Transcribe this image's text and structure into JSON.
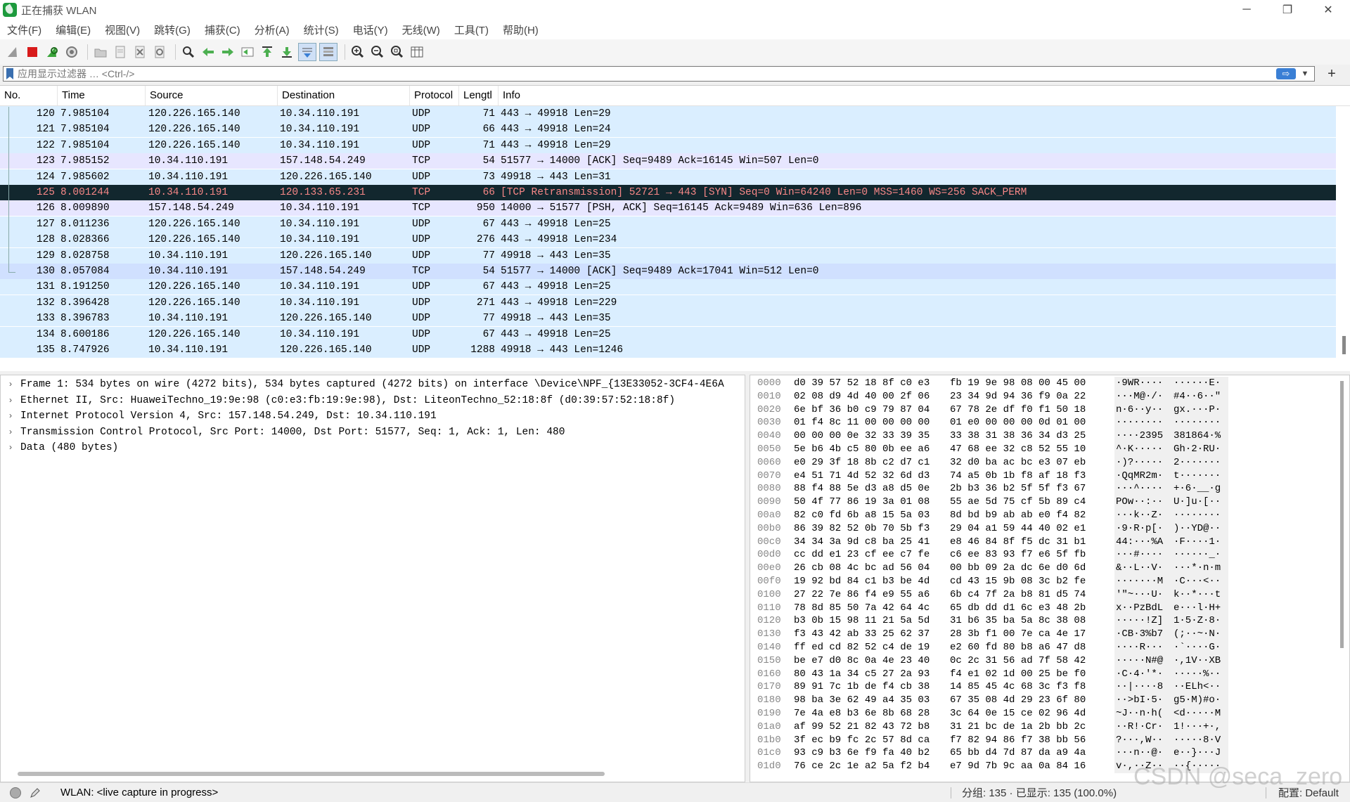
{
  "window": {
    "title": "正在捕获 WLAN",
    "minimize": "─",
    "restore": "❐",
    "close": "✕"
  },
  "menu": [
    "文件(F)",
    "编辑(E)",
    "视图(V)",
    "跳转(G)",
    "捕获(C)",
    "分析(A)",
    "统计(S)",
    "电话(Y)",
    "无线(W)",
    "工具(T)",
    "帮助(H)"
  ],
  "toolbar": {
    "icons": [
      "shark-fin-start-icon",
      "stop-capture-icon",
      "restart-capture-icon",
      "capture-options-icon",
      "sep",
      "open-file-icon",
      "save-file-icon",
      "close-file-icon",
      "reload-file-icon",
      "sep",
      "find-packet-icon",
      "go-back-icon",
      "go-forward-icon",
      "go-to-packet-icon",
      "go-first-icon",
      "go-last-icon",
      "auto-scroll-icon",
      "colorize-icon",
      "sep",
      "zoom-in-icon",
      "zoom-out-icon",
      "zoom-normal-icon",
      "resize-columns-icon"
    ]
  },
  "filter": {
    "placeholder": "应用显示过滤器 … <Ctrl-/>",
    "apply": "⇨",
    "dropdown": "▼",
    "add": "+"
  },
  "packet_list": {
    "columns": [
      "No.",
      "Time",
      "Source",
      "Destination",
      "Protocol",
      "Lengtl",
      "Info"
    ],
    "rows": [
      {
        "no": "120",
        "time": "7.985104",
        "src": "120.226.165.140",
        "dst": "10.34.110.191",
        "proto": "UDP",
        "len": "71",
        "info": "443 → 49918 Len=29",
        "style": "udp"
      },
      {
        "no": "121",
        "time": "7.985104",
        "src": "120.226.165.140",
        "dst": "10.34.110.191",
        "proto": "UDP",
        "len": "66",
        "info": "443 → 49918 Len=24",
        "style": "udp"
      },
      {
        "no": "122",
        "time": "7.985104",
        "src": "120.226.165.140",
        "dst": "10.34.110.191",
        "proto": "UDP",
        "len": "71",
        "info": "443 → 49918 Len=29",
        "style": "udp"
      },
      {
        "no": "123",
        "time": "7.985152",
        "src": "10.34.110.191",
        "dst": "157.148.54.249",
        "proto": "TCP",
        "len": "54",
        "info": "51577 → 14000 [ACK] Seq=9489 Ack=16145 Win=507 Len=0",
        "style": "tcp"
      },
      {
        "no": "124",
        "time": "7.985602",
        "src": "10.34.110.191",
        "dst": "120.226.165.140",
        "proto": "UDP",
        "len": "73",
        "info": "49918 → 443 Len=31",
        "style": "udp"
      },
      {
        "no": "125",
        "time": "8.001244",
        "src": "10.34.110.191",
        "dst": "120.133.65.231",
        "proto": "TCP",
        "len": "66",
        "info": "[TCP Retransmission] 52721 → 443 [SYN] Seq=0 Win=64240 Len=0 MSS=1460 WS=256 SACK_PERM",
        "style": "sel"
      },
      {
        "no": "126",
        "time": "8.009890",
        "src": "157.148.54.249",
        "dst": "10.34.110.191",
        "proto": "TCP",
        "len": "950",
        "info": "14000 → 51577 [PSH, ACK] Seq=16145 Ack=9489 Win=636 Len=896",
        "style": "tcp"
      },
      {
        "no": "127",
        "time": "8.011236",
        "src": "120.226.165.140",
        "dst": "10.34.110.191",
        "proto": "UDP",
        "len": "67",
        "info": "443 → 49918 Len=25",
        "style": "udp"
      },
      {
        "no": "128",
        "time": "8.028366",
        "src": "120.226.165.140",
        "dst": "10.34.110.191",
        "proto": "UDP",
        "len": "276",
        "info": "443 → 49918 Len=234",
        "style": "udp"
      },
      {
        "no": "129",
        "time": "8.028758",
        "src": "10.34.110.191",
        "dst": "120.226.165.140",
        "proto": "UDP",
        "len": "77",
        "info": "49918 → 443 Len=35",
        "style": "udp"
      },
      {
        "no": "130",
        "time": "8.057084",
        "src": "10.34.110.191",
        "dst": "157.148.54.249",
        "proto": "TCP",
        "len": "54",
        "info": "51577 → 14000 [ACK] Seq=9489 Ack=17041 Win=512 Len=0",
        "style": "hl"
      },
      {
        "no": "131",
        "time": "8.191250",
        "src": "120.226.165.140",
        "dst": "10.34.110.191",
        "proto": "UDP",
        "len": "67",
        "info": "443 → 49918 Len=25",
        "style": "udp"
      },
      {
        "no": "132",
        "time": "8.396428",
        "src": "120.226.165.140",
        "dst": "10.34.110.191",
        "proto": "UDP",
        "len": "271",
        "info": "443 → 49918 Len=229",
        "style": "udp"
      },
      {
        "no": "133",
        "time": "8.396783",
        "src": "10.34.110.191",
        "dst": "120.226.165.140",
        "proto": "UDP",
        "len": "77",
        "info": "49918 → 443 Len=35",
        "style": "udp"
      },
      {
        "no": "134",
        "time": "8.600186",
        "src": "120.226.165.140",
        "dst": "10.34.110.191",
        "proto": "UDP",
        "len": "67",
        "info": "443 → 49918 Len=25",
        "style": "udp"
      },
      {
        "no": "135",
        "time": "8.747926",
        "src": "10.34.110.191",
        "dst": "120.226.165.140",
        "proto": "UDP",
        "len": "1288",
        "info": "49918 → 443 Len=1246",
        "style": "udp"
      }
    ]
  },
  "details": [
    "Frame 1: 534 bytes on wire (4272 bits), 534 bytes captured (4272 bits) on interface \\Device\\NPF_{13E33052-3CF4-4E6A",
    "Ethernet II, Src: HuaweiTechno_19:9e:98 (c0:e3:fb:19:9e:98), Dst: LiteonTechno_52:18:8f (d0:39:57:52:18:8f)",
    "Internet Protocol Version 4, Src: 157.148.54.249, Dst: 10.34.110.191",
    "Transmission Control Protocol, Src Port: 14000, Dst Port: 51577, Seq: 1, Ack: 1, Len: 480",
    "Data (480 bytes)"
  ],
  "bytes": [
    {
      "off": "0000",
      "h1": "d0 39 57 52 18 8f c0 e3",
      "h2": "fb 19 9e 98 08 00 45 00",
      "a1": "·9WR····",
      "a2": "······E·"
    },
    {
      "off": "0010",
      "h1": "02 08 d9 4d 40 00 2f 06",
      "h2": "23 34 9d 94 36 f9 0a 22",
      "a1": "···M@·/·",
      "a2": "#4··6··\""
    },
    {
      "off": "0020",
      "h1": "6e bf 36 b0 c9 79 87 04",
      "h2": "67 78 2e df f0 f1 50 18",
      "a1": "n·6··y··",
      "a2": "gx.···P·"
    },
    {
      "off": "0030",
      "h1": "01 f4 8c 11 00 00 00 00",
      "h2": "01 e0 00 00 00 0d 01 00",
      "a1": "········",
      "a2": "········"
    },
    {
      "off": "0040",
      "h1": "00 00 00 0e 32 33 39 35",
      "h2": "33 38 31 38 36 34 d3 25",
      "a1": "····2395",
      "a2": "381864·%"
    },
    {
      "off": "0050",
      "h1": "5e b6 4b c5 80 0b ee a6",
      "h2": "47 68 ee 32 c8 52 55 10",
      "a1": "^·K·····",
      "a2": "Gh·2·RU·"
    },
    {
      "off": "0060",
      "h1": "e0 29 3f 18 8b c2 d7 c1",
      "h2": "32 d0 ba ac bc e3 07 eb",
      "a1": "·)?·····",
      "a2": "2·······"
    },
    {
      "off": "0070",
      "h1": "e4 51 71 4d 52 32 6d d3",
      "h2": "74 a5 0b 1b f8 af 18 f3",
      "a1": "·QqMR2m·",
      "a2": "t·······"
    },
    {
      "off": "0080",
      "h1": "88 f4 88 5e d3 a8 d5 0e",
      "h2": "2b b3 36 b2 5f 5f f3 67",
      "a1": "···^····",
      "a2": "+·6·__·g"
    },
    {
      "off": "0090",
      "h1": "50 4f 77 86 19 3a 01 08",
      "h2": "55 ae 5d 75 cf 5b 89 c4",
      "a1": "POw··:··",
      "a2": "U·]u·[··"
    },
    {
      "off": "00a0",
      "h1": "82 c0 fd 6b a8 15 5a 03",
      "h2": "8d bd b9 ab ab e0 f4 82",
      "a1": "···k··Z·",
      "a2": "········"
    },
    {
      "off": "00b0",
      "h1": "86 39 82 52 0b 70 5b f3",
      "h2": "29 04 a1 59 44 40 02 e1",
      "a1": "·9·R·p[·",
      "a2": ")··YD@··"
    },
    {
      "off": "00c0",
      "h1": "34 34 3a 9d c8 ba 25 41",
      "h2": "e8 46 84 8f f5 dc 31 b1",
      "a1": "44:···%A",
      "a2": "·F····1·"
    },
    {
      "off": "00d0",
      "h1": "cc dd e1 23 cf ee c7 fe",
      "h2": "c6 ee 83 93 f7 e6 5f fb",
      "a1": "···#····",
      "a2": "······_·"
    },
    {
      "off": "00e0",
      "h1": "26 cb 08 4c bc ad 56 04",
      "h2": "00 bb 09 2a dc 6e d0 6d",
      "a1": "&··L··V·",
      "a2": "···*·n·m"
    },
    {
      "off": "00f0",
      "h1": "19 92 bd 84 c1 b3 be 4d",
      "h2": "cd 43 15 9b 08 3c b2 fe",
      "a1": "·······M",
      "a2": "·C···<··"
    },
    {
      "off": "0100",
      "h1": "27 22 7e 86 f4 e9 55 a6",
      "h2": "6b c4 7f 2a b8 81 d5 74",
      "a1": "'\"~···U·",
      "a2": "k··*···t"
    },
    {
      "off": "0110",
      "h1": "78 8d 85 50 7a 42 64 4c",
      "h2": "65 db dd d1 6c e3 48 2b",
      "a1": "x··PzBdL",
      "a2": "e···l·H+"
    },
    {
      "off": "0120",
      "h1": "b3 0b 15 98 11 21 5a 5d",
      "h2": "31 b6 35 ba 5a 8c 38 08",
      "a1": "·····!Z]",
      "a2": "1·5·Z·8·"
    },
    {
      "off": "0130",
      "h1": "f3 43 42 ab 33 25 62 37",
      "h2": "28 3b f1 00 7e ca 4e 17",
      "a1": "·CB·3%b7",
      "a2": "(;··~·N·"
    },
    {
      "off": "0140",
      "h1": "ff ed cd 82 52 c4 de 19",
      "h2": "e2 60 fd 80 b8 a6 47 d8",
      "a1": "····R···",
      "a2": "·`····G·"
    },
    {
      "off": "0150",
      "h1": "be e7 d0 8c 0a 4e 23 40",
      "h2": "0c 2c 31 56 ad 7f 58 42",
      "a1": "·····N#@",
      "a2": "·,1V··XB"
    },
    {
      "off": "0160",
      "h1": "80 43 1a 34 c5 27 2a 93",
      "h2": "f4 e1 02 1d 00 25 be f0",
      "a1": "·C·4·'*·",
      "a2": "·····%··"
    },
    {
      "off": "0170",
      "h1": "89 91 7c 1b de f4 cb 38",
      "h2": "14 85 45 4c 68 3c f3 f8",
      "a1": "··|····8",
      "a2": "··ELh<··"
    },
    {
      "off": "0180",
      "h1": "98 ba 3e 62 49 a4 35 03",
      "h2": "67 35 08 4d 29 23 6f 80",
      "a1": "··>bI·5·",
      "a2": "g5·M)#o·"
    },
    {
      "off": "0190",
      "h1": "7e 4a e8 b3 6e 8b 68 28",
      "h2": "3c 64 0e 15 ce 02 96 4d",
      "a1": "~J··n·h(",
      "a2": "<d·····M"
    },
    {
      "off": "01a0",
      "h1": "af 99 52 21 82 43 72 b8",
      "h2": "31 21 bc de 1a 2b bb 2c",
      "a1": "··R!·Cr·",
      "a2": "1!···+·,"
    },
    {
      "off": "01b0",
      "h1": "3f ec b9 fc 2c 57 8d ca",
      "h2": "f7 82 94 86 f7 38 bb 56",
      "a1": "?···,W··",
      "a2": "·····8·V"
    },
    {
      "off": "01c0",
      "h1": "93 c9 b3 6e f9 fa 40 b2",
      "h2": "65 bb d4 7d 87 da a9 4a",
      "a1": "···n··@·",
      "a2": "e··}···J"
    },
    {
      "off": "01d0",
      "h1": "76 ce 2c 1e a2 5a f2 b4",
      "h2": "e7 9d 7b 9c aa 0a 84 16",
      "a1": "v·,··Z··",
      "a2": "··{·····"
    }
  ],
  "status": {
    "capture": "WLAN: <live capture in progress>",
    "packets": "分组: 135 · 已显示: 135 (100.0%)",
    "profile": "配置: Default",
    "watermark": "CSDN @seca_zero"
  }
}
